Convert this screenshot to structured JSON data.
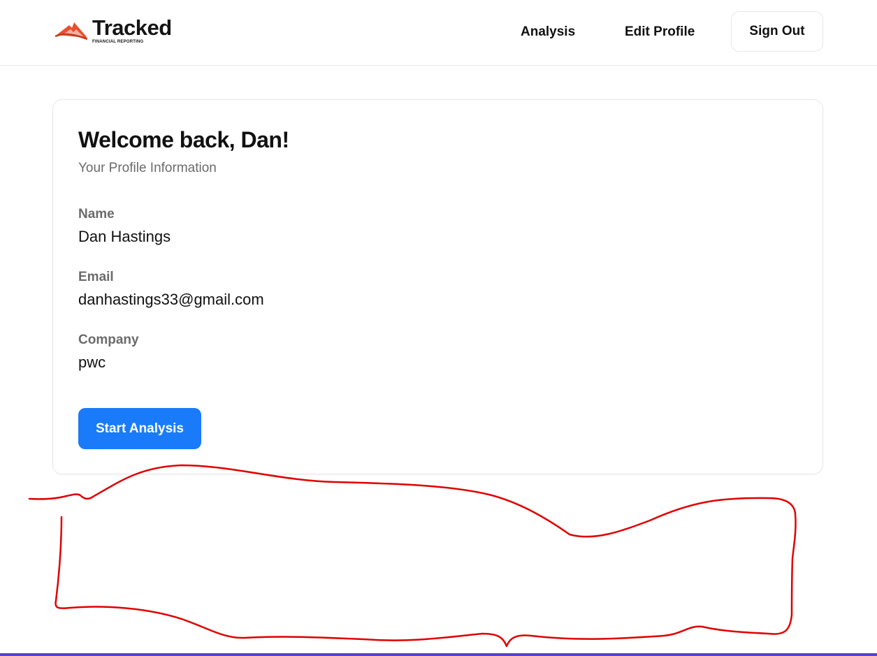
{
  "header": {
    "brand": {
      "name": "Tracked",
      "tagline": "FINANCIAL REPORTING",
      "icon": "mountain-logo-icon",
      "accent_color": "#e8502f"
    },
    "nav": {
      "analysis_label": "Analysis",
      "edit_profile_label": "Edit Profile",
      "sign_out_label": "Sign Out"
    }
  },
  "profile_card": {
    "title": "Welcome back, Dan!",
    "subtitle": "Your Profile Information",
    "fields": [
      {
        "label": "Name",
        "value": "Dan Hastings"
      },
      {
        "label": "Email",
        "value": "danhastings33@gmail.com"
      },
      {
        "label": "Company",
        "value": "pwc"
      }
    ],
    "start_button_label": "Start Analysis",
    "button_color": "#1a7bfa"
  },
  "annotation": {
    "color": "#e00000",
    "kind": "hand-drawn-outline"
  }
}
